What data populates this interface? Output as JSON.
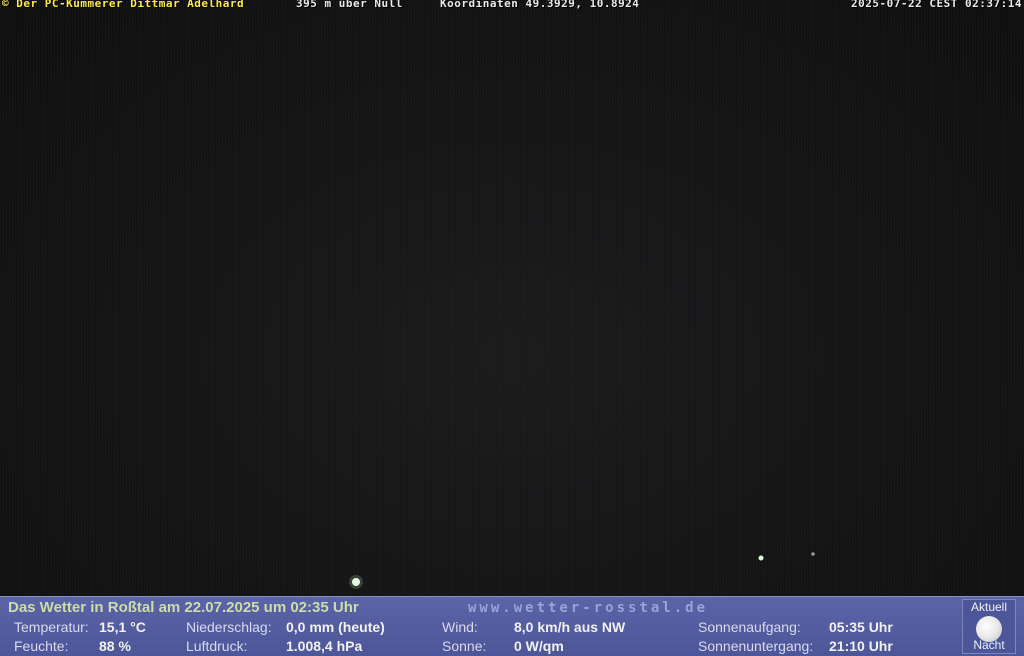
{
  "overlay": {
    "copyright": "© Der PC-Kümmerer Dittmar Adelhard",
    "altitude": "395 m über Null",
    "coordinates": "Koordinaten 49.3929, 10.8924",
    "datetime": "2025-07-22 CEST 02:37:14"
  },
  "panel": {
    "title": "Das Wetter in Roßtal am 22.07.2025 um 02:35 Uhr",
    "url": "www.wetter-rosstal.de",
    "temp_label": "Temperatur:",
    "temp_value": "15,1 °C",
    "humidity_label": "Feuchte:",
    "humidity_value": "88 %",
    "rain_label": "Niederschlag:",
    "rain_value": "0,0 mm (heute)",
    "pressure_label": "Luftdruck:",
    "pressure_value": "1.008,4 hPa",
    "wind_label": "Wind:",
    "wind_value": "8,0 km/h aus NW",
    "sun_label": "Sonne:",
    "sun_value": "0 W/qm",
    "sunrise_label": "Sonnenaufgang:",
    "sunrise_value": "05:35 Uhr",
    "sunset_label": "Sonnenuntergang:",
    "sunset_value": "21:10 Uhr",
    "moon_top": "Aktuell",
    "moon_bottom": "Nacht"
  }
}
